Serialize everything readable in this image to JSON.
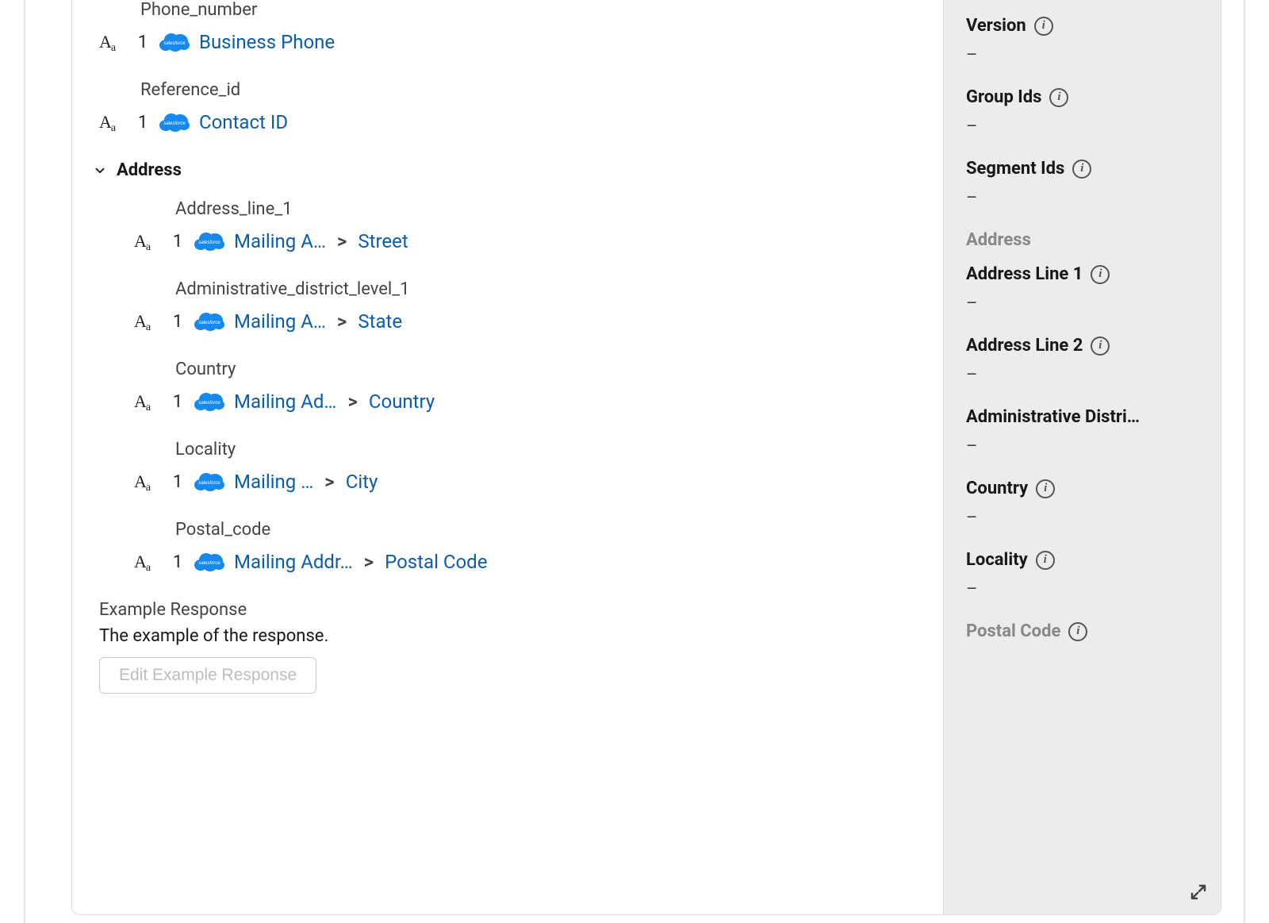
{
  "main": {
    "fields": [
      {
        "label": "Phone_number",
        "priority": "1",
        "link": "Business Phone",
        "tail": null,
        "indented": false
      },
      {
        "label": "Reference_id",
        "priority": "1",
        "link": "Contact ID",
        "tail": null,
        "indented": false
      }
    ],
    "address_section": {
      "title": "Address",
      "fields": [
        {
          "label": "Address_line_1",
          "priority": "1",
          "link": "Mailing A…",
          "tail": "Street"
        },
        {
          "label": "Administrative_district_level_1",
          "priority": "1",
          "link": "Mailing A…",
          "tail": "State"
        },
        {
          "label": "Country",
          "priority": "1",
          "link": "Mailing Ad…",
          "tail": "Country"
        },
        {
          "label": "Locality",
          "priority": "1",
          "link": "Mailing …",
          "tail": "City"
        },
        {
          "label": "Postal_code",
          "priority": "1",
          "link": "Mailing Addr…",
          "tail": "Postal Code"
        }
      ]
    },
    "example": {
      "title": "Example Response",
      "desc": "The example of the response.",
      "button": "Edit Example Response"
    }
  },
  "sidebar": {
    "fields_top": [
      {
        "label": "Version",
        "value": "–",
        "info": true
      },
      {
        "label": "Group Ids",
        "value": "–",
        "info": true
      },
      {
        "label": "Segment Ids",
        "value": "–",
        "info": true
      }
    ],
    "address_heading": "Address",
    "address_fields": [
      {
        "label": "Address Line 1",
        "value": "–",
        "info": true,
        "muted": false
      },
      {
        "label": "Address Line 2",
        "value": "–",
        "info": true,
        "muted": false
      },
      {
        "label": "Administrative Distri…",
        "value": "–",
        "info": false,
        "muted": false,
        "truncate": true
      },
      {
        "label": "Country",
        "value": "–",
        "info": true,
        "muted": false
      },
      {
        "label": "Locality",
        "value": "–",
        "info": true,
        "muted": false
      },
      {
        "label": "Postal Code",
        "value": null,
        "info": true,
        "muted": true
      }
    ]
  },
  "breadcrumb_sep": ">"
}
